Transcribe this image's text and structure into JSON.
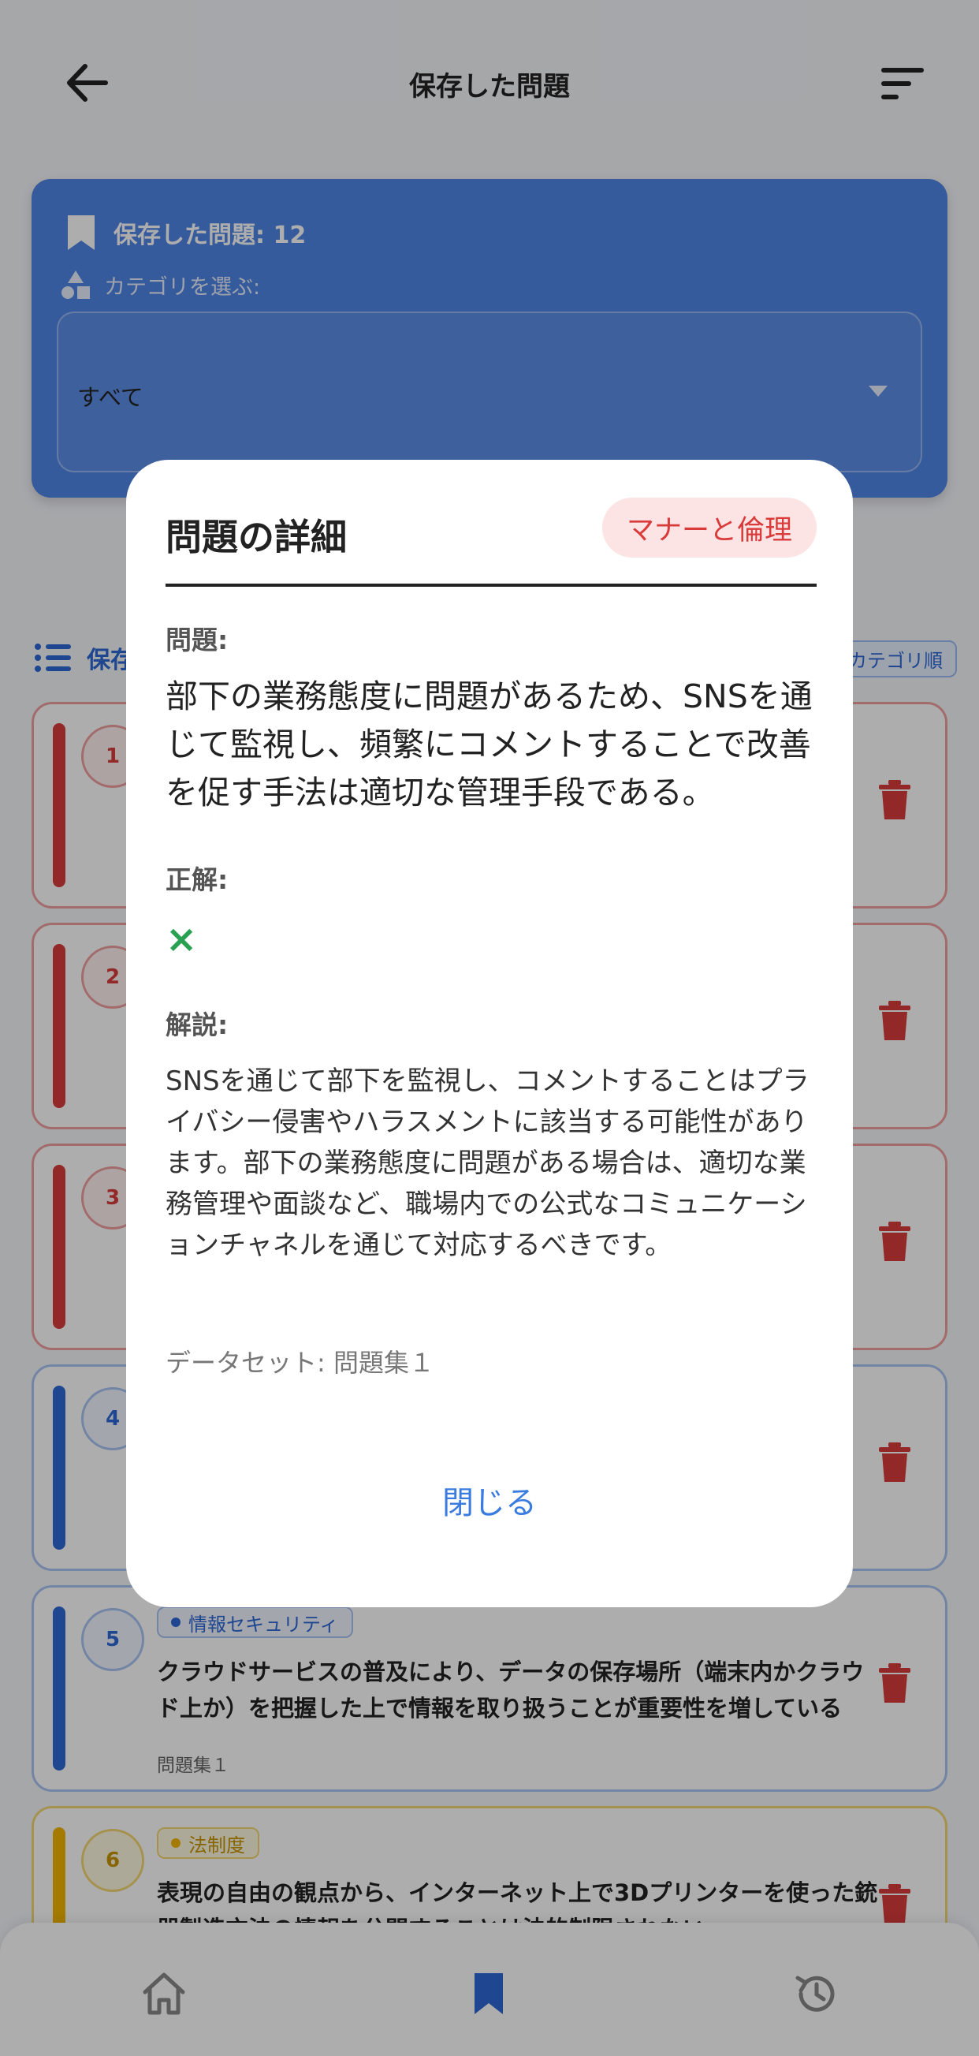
{
  "header": {
    "title": "保存した問題",
    "back_icon": "arrow-left-icon",
    "sort_icon": "sort-lines-icon"
  },
  "summary": {
    "saved_count_label": "保存した問題: 12",
    "category_label": "カテゴリを選ぶ:",
    "selected_category": "すべて"
  },
  "list": {
    "header_label": "保存",
    "sort_chip": "カテゴリ順"
  },
  "questions": [
    {
      "number": "1",
      "color": "#d93b3b"
    },
    {
      "number": "2",
      "color": "#d93b3b"
    },
    {
      "number": "3",
      "color": "#d93b3b"
    },
    {
      "number": "4",
      "color": "#2e67d6"
    },
    {
      "number": "5",
      "color": "#2e67d6",
      "category": "情報セキュリティ",
      "text": "クラウドサービスの普及により、データの保存場所（端末内かクラウド上か）を把握した上で情報を取り扱うことが重要性を増している",
      "dataset": "問題集１"
    },
    {
      "number": "6",
      "color": "#f2b600",
      "category": "法制度",
      "text": "表現の自由の観点から、インターネット上で3Dプリンターを使った銃器製造方法の情報を公開することは法的制限されない"
    }
  ],
  "modal": {
    "title": "問題の詳細",
    "category_chip": "マナーと倫理",
    "question_label": "問題:",
    "question_text": "部下の業務態度に問題があるため、SNSを通じて監視し、頻繁にコメントすることで改善を促す手法は適切な管理手段である。",
    "answer_label": "正解:",
    "answer_mark": "×",
    "explanation_label": "解説:",
    "explanation_text": "SNSを通じて部下を監視し、コメントすることはプライバシー侵害やハラスメントに該当する可能性があります。部下の業務態度に問題がある場合は、適切な業務管理や面談など、職場内での公式なコミュニケーションチャネルを通じて対応するべきです。",
    "dataset_text": "データセット: 問題集１",
    "close_label": "閉じる"
  },
  "bottom_nav": {
    "items": [
      "home-icon",
      "bookmark-icon",
      "history-icon"
    ]
  },
  "colors": {
    "primary": "#4f86e6",
    "red": "#d93b3b",
    "blue": "#2e67d6",
    "yellow": "#f2b600",
    "green": "#2aa052"
  }
}
